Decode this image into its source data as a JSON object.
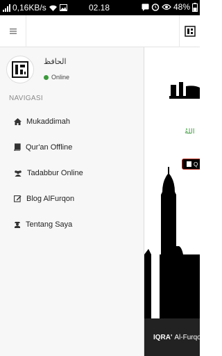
{
  "status_bar": {
    "network_speed": "0,16KB/s",
    "time": "02.18",
    "battery": "48%",
    "icons": [
      "signal-icon",
      "wifi-icon",
      "image-icon",
      "chat-icon",
      "alarm-icon",
      "eye-icon",
      "battery-icon"
    ]
  },
  "app_bar": {
    "menu_icon": "hamburger-icon",
    "logo_icon": "iqra-logo-icon"
  },
  "user": {
    "name": "الحافظ",
    "status": "Online",
    "status_color": "#3c9a3c"
  },
  "nav": {
    "header": "NAVIGASI",
    "items": [
      {
        "label": "Mukaddimah",
        "icon": "home-icon"
      },
      {
        "label": "Qur'an Offline",
        "icon": "book-icon"
      },
      {
        "label": "Tadabbur Online",
        "icon": "users-icon"
      },
      {
        "label": "Blog AlFurqon",
        "icon": "edit-icon"
      },
      {
        "label": "Tentang Saya",
        "icon": "user-secret-icon"
      }
    ]
  },
  "content": {
    "arabic_text": "اللهُ",
    "quran_button_label": "Q",
    "footer_brand": "IQRA'",
    "footer_text": "Al-Furqo"
  }
}
